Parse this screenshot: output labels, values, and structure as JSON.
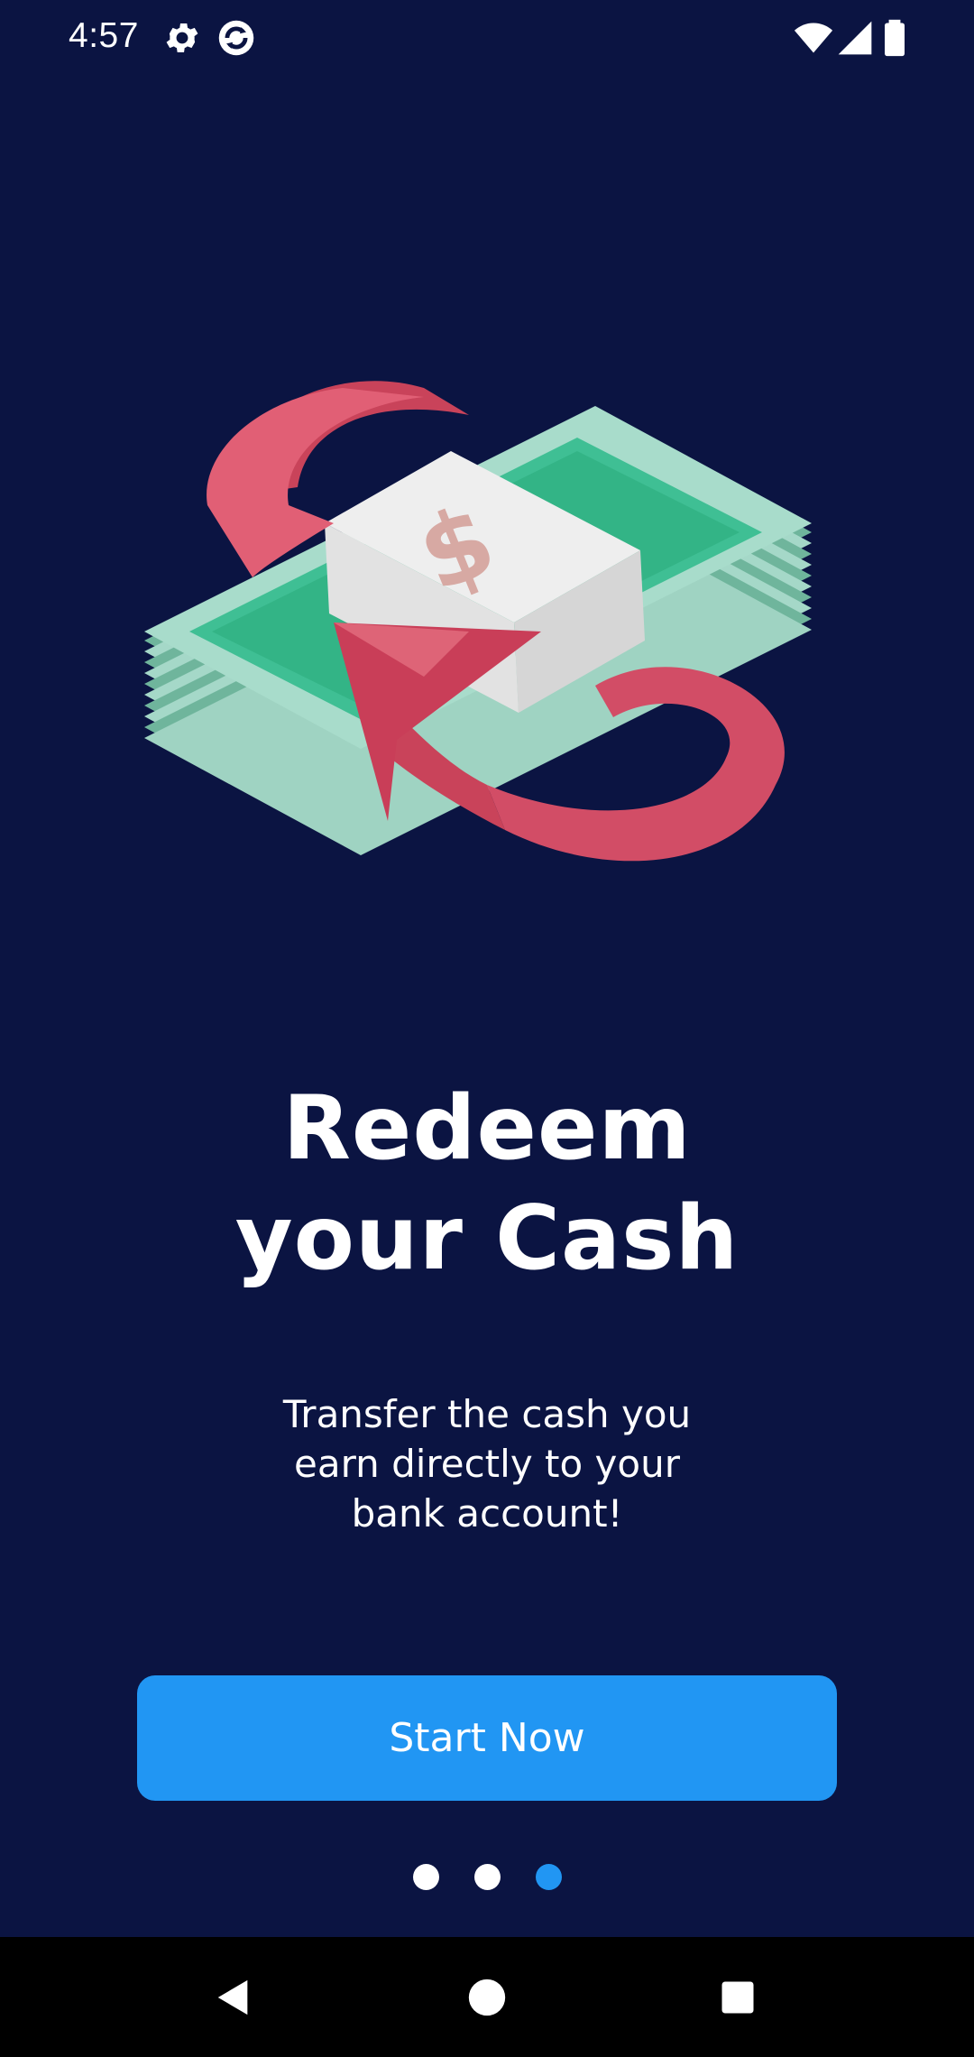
{
  "status_bar": {
    "time": "4:57",
    "icons": [
      "settings-icon",
      "sync-app-icon",
      "wifi-icon",
      "cell-signal-icon",
      "battery-icon"
    ]
  },
  "onboarding": {
    "illustration": "money-stack-with-circular-arrow",
    "title_line1": "Redeem",
    "title_line2": "your Cash",
    "subtitle_line1": "Transfer the cash you",
    "subtitle_line2": "earn directly to your",
    "subtitle_line3": "bank account!",
    "cta_label": "Start Now",
    "pager": {
      "total": 3,
      "active_index": 3
    }
  },
  "nav_bar": {
    "buttons": [
      "back-icon",
      "home-icon",
      "recents-icon"
    ]
  },
  "colors": {
    "background": "#0b1442",
    "accent": "#2196f3",
    "text": "#ffffff",
    "nav_bar": "#000000"
  }
}
